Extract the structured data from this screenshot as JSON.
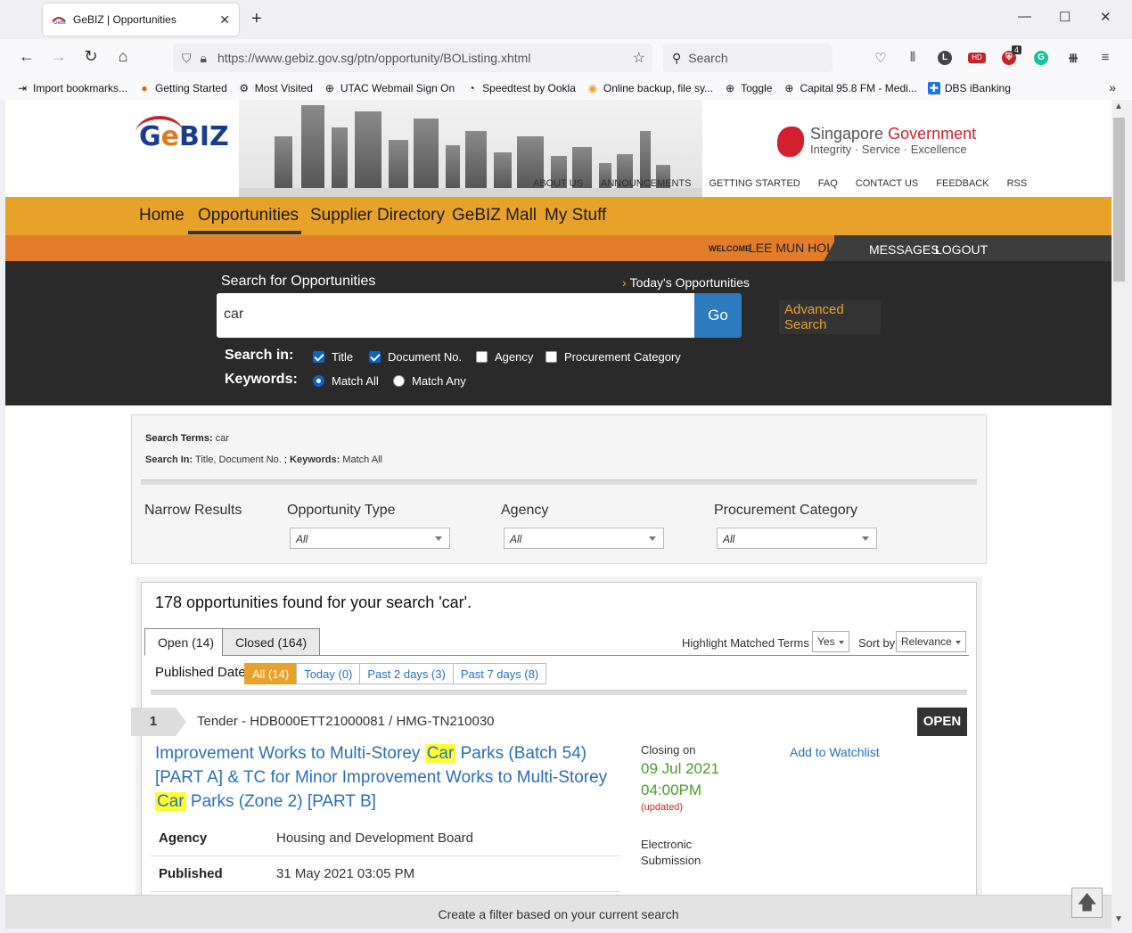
{
  "browser": {
    "tab_title": "GeBIZ | Opportunities",
    "url": "https://www.gebiz.gov.sg/ptn/opportunity/BOListing.xhtml",
    "search_placeholder": "Search",
    "badge_count": "4",
    "profile_letter": "L",
    "hd_label": "HD",
    "bookmarks": [
      "Import bookmarks...",
      "Getting Started",
      "Most Visited",
      "UTAC Webmail Sign On",
      "Speedtest by Ookla",
      "Online backup, file sy...",
      "Toggle",
      "Capital 95.8 FM - Medi...",
      "DBS iBanking"
    ]
  },
  "header": {
    "logo_g": "G",
    "logo_e": "e",
    "logo_biz": "BIZ",
    "sg_word1": "Singapore",
    "sg_word2": "Government",
    "sg_tagline": "Integrity · Service · Excellence",
    "top_links": [
      "ABOUT US",
      "ANNOUNCEMENTS",
      "GETTING STARTED",
      "FAQ",
      "CONTACT US",
      "FEEDBACK",
      "RSS"
    ]
  },
  "nav": {
    "items": [
      "Home",
      "Opportunities",
      "Supplier Directory",
      "GeBIZ Mall",
      "My Stuff"
    ],
    "active": "Opportunities"
  },
  "user": {
    "welcome": "WELCOME",
    "name": "LEE MUN HOI",
    "messages": "MESSAGES",
    "logout": "LOGOUT"
  },
  "search": {
    "label": "Search for Opportunities",
    "today_link": "Today's Opportunities",
    "query": "car",
    "go_label": "Go",
    "advanced": "Advanced Search",
    "search_in_label": "Search in:",
    "keywords_label": "Keywords:",
    "search_in": [
      {
        "label": "Title",
        "checked": true
      },
      {
        "label": "Document No.",
        "checked": true
      },
      {
        "label": "Agency",
        "checked": false
      },
      {
        "label": "Procurement Category",
        "checked": false
      }
    ],
    "keywords": [
      {
        "label": "Match All",
        "selected": true
      },
      {
        "label": "Match Any",
        "selected": false
      }
    ]
  },
  "summary": {
    "terms_label": "Search Terms:",
    "terms_value": "car",
    "in_label": "Search In:",
    "in_value": "Title, Document No. ;",
    "kw_label": "Keywords:",
    "kw_value": "Match All",
    "narrow": "Narrow Results",
    "filters": [
      {
        "label": "Opportunity Type",
        "value": "All"
      },
      {
        "label": "Agency",
        "value": "All"
      },
      {
        "label": "Procurement Category",
        "value": "All"
      }
    ]
  },
  "results": {
    "found_text": "178 opportunities found for your search 'car'.",
    "tabs": [
      "Open (14)",
      "Closed (164)"
    ],
    "highlight_label": "Highlight Matched Terms",
    "highlight_value": "Yes",
    "sort_label": "Sort by",
    "sort_value": "Relevance",
    "published_label": "Published Date:",
    "date_pills": [
      "All (14)",
      "Today (0)",
      "Past 2 days (3)",
      "Past 7 days (8)"
    ],
    "items": [
      {
        "number": "1",
        "doc": "Tender - HDB000ETT21000081 / HMG-TN210030",
        "status": "OPEN",
        "title_parts": [
          "Improvement Works to Multi-Storey ",
          "Car",
          " Parks (Batch 54) [PART A] & TC for Minor Improvement Works to Multi-Storey ",
          "Car",
          " Parks (Zone 2) [PART B]"
        ],
        "closing_label": "Closing on",
        "closing_date": "09 Jul 2021",
        "closing_time": "04:00PM",
        "updated": "(updated)",
        "watchlist": "Add to Watchlist",
        "submission": "Electronic Submission",
        "agency_label": "Agency",
        "agency": "Housing and Development Board",
        "published_label": "Published",
        "published": "31 May 2021 03:05 PM"
      }
    ]
  },
  "footer": {
    "filter_bar": "Create a filter based on your current search"
  }
}
